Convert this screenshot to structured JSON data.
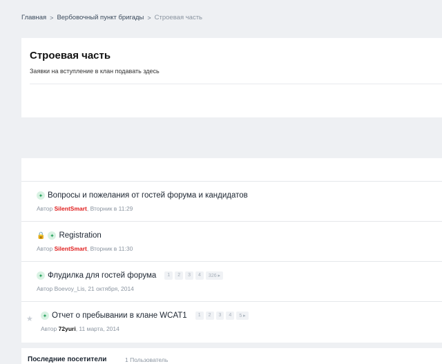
{
  "breadcrumb": {
    "items": [
      "Главная",
      "Вербовочный пункт бригады",
      "Строевая часть"
    ],
    "separator": ">"
  },
  "forum": {
    "title": "Строевая часть",
    "description": "Заявки на вступление в клан подавать здесь"
  },
  "topics": [
    {
      "title": "Вопросы и пожелания от гостей форума и кандидатов",
      "meta_prefix": "Автор",
      "author": "SilentSmart",
      "date": ", Вторник в 11:29",
      "pinned": true,
      "locked": false,
      "starred": false,
      "pages": []
    },
    {
      "title": "Registration",
      "meta_prefix": "Автор",
      "author": "SilentSmart",
      "date": ", Вторник в 11:30",
      "pinned": true,
      "locked": true,
      "starred": false,
      "pages": []
    },
    {
      "title": "Флудилка для гостей форума",
      "meta_prefix": "Автор",
      "author": "Boevoy_Lis",
      "date": ", 21 октября, 2014",
      "pinned": true,
      "locked": false,
      "starred": false,
      "pages": [
        "1",
        "2",
        "3",
        "4",
        "326 ▸"
      ]
    },
    {
      "title": "Отчет о пребывании в клане WCAT1",
      "meta_prefix": "Автор",
      "author": "72yuri",
      "date": ", 11 марта, 2014",
      "pinned": true,
      "locked": false,
      "starred": true,
      "pages": [
        "1",
        "2",
        "3",
        "4",
        "5 ▸"
      ]
    }
  ],
  "recent_visitors": {
    "title": "Последние посетители",
    "count": "1 Пользователь"
  },
  "colors": {
    "author_highlight": "#e01b1b",
    "pin_green": "#2aa35f",
    "background": "#eef0f3"
  },
  "icons": {
    "pin": "pin-icon",
    "lock": "lock-icon",
    "star": "star-icon",
    "separator": "chevron-right-icon"
  }
}
